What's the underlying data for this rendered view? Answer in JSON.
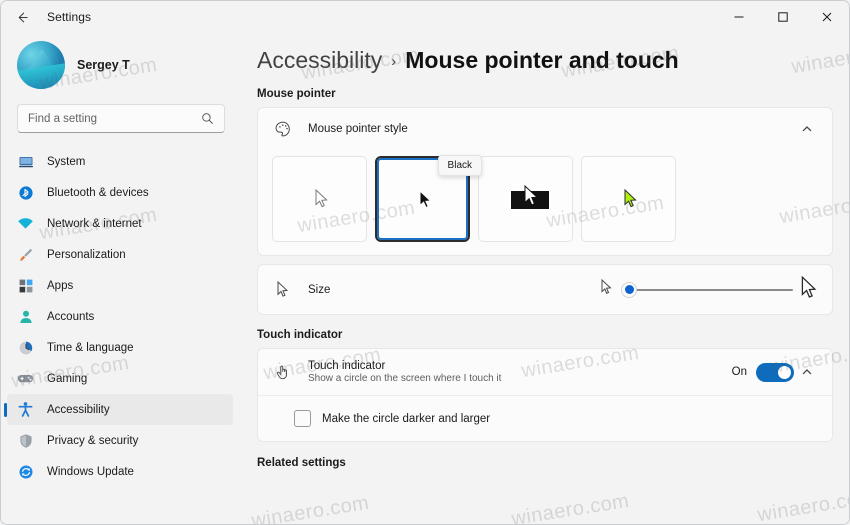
{
  "window": {
    "title": "Settings",
    "back_icon": "back-arrow-icon",
    "minimize_label": "Minimize",
    "maximize_label": "Maximize",
    "close_label": "Close"
  },
  "sidebar": {
    "profile": {
      "name": "Sergey T",
      "avatar_icon": "avatar"
    },
    "search": {
      "placeholder": "Find a setting",
      "value": "",
      "icon": "search-icon"
    },
    "items": [
      {
        "label": "System",
        "icon": "monitor-icon",
        "active": false
      },
      {
        "label": "Bluetooth & devices",
        "icon": "bluetooth-icon",
        "active": false
      },
      {
        "label": "Network & internet",
        "icon": "wifi-icon",
        "active": false
      },
      {
        "label": "Personalization",
        "icon": "paintbrush-icon",
        "active": false
      },
      {
        "label": "Apps",
        "icon": "apps-icon",
        "active": false
      },
      {
        "label": "Accounts",
        "icon": "person-icon",
        "active": false
      },
      {
        "label": "Time & language",
        "icon": "clock-icon",
        "active": false
      },
      {
        "label": "Gaming",
        "icon": "gamepad-icon",
        "active": false
      },
      {
        "label": "Accessibility",
        "icon": "accessibility-icon",
        "active": true
      },
      {
        "label": "Privacy & security",
        "icon": "shield-icon",
        "active": false
      },
      {
        "label": "Windows Update",
        "icon": "update-icon",
        "active": false
      }
    ]
  },
  "main": {
    "breadcrumb": {
      "parent": "Accessibility",
      "separator": "›",
      "current": "Mouse pointer and touch"
    },
    "sections": [
      {
        "heading": "Mouse pointer"
      },
      {
        "heading": "Touch indicator"
      },
      {
        "heading": "Related settings"
      }
    ],
    "pointer_style": {
      "row_title": "Mouse pointer style",
      "row_icon": "palette-icon",
      "expand_icon": "chevron-up-icon",
      "tooltip": "Black",
      "options": [
        {
          "name": "White",
          "selected": false
        },
        {
          "name": "Black",
          "selected": true
        },
        {
          "name": "Inverted",
          "selected": false
        },
        {
          "name": "Custom",
          "selected": false
        }
      ]
    },
    "size": {
      "row_title": "Size",
      "row_icon": "cursor-small-icon",
      "slider_value": 1,
      "slider_min": 1,
      "slider_max": 15,
      "left_icon": "cursor-small-icon",
      "right_icon": "cursor-large-icon"
    },
    "touch_indicator": {
      "row_title": "Touch indicator",
      "row_sub": "Show a circle on the screen where I touch it",
      "row_icon": "touch-hand-icon",
      "toggle_state": "On",
      "expand_icon": "chevron-up-icon",
      "checkbox_label": "Make the circle darker and larger",
      "checkbox_checked": false
    }
  },
  "watermark": {
    "text": "winaero.com"
  },
  "colors": {
    "accent": "#0f6cbd",
    "selection_border": "#1d6fc4",
    "sidebar_bg": "#f3f3f3",
    "card_bg": "#fbfbfb",
    "text": "#1b1b1b"
  }
}
